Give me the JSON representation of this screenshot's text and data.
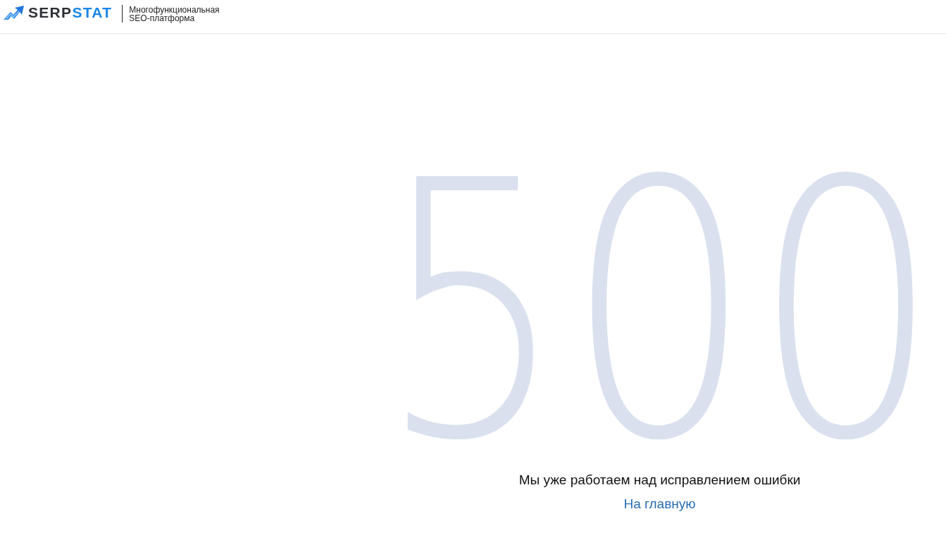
{
  "header": {
    "logo": {
      "parts": [
        {
          "text": "SERP",
          "color": "#2d3036"
        },
        {
          "text": "STAT",
          "color": "#1a86e8"
        }
      ]
    },
    "tagline": [
      "Многофункциональная",
      "SEO-платформа"
    ]
  },
  "error": {
    "code": "500",
    "message": "Мы уже работаем над исправлением ошибки",
    "home_link": "На главную"
  }
}
